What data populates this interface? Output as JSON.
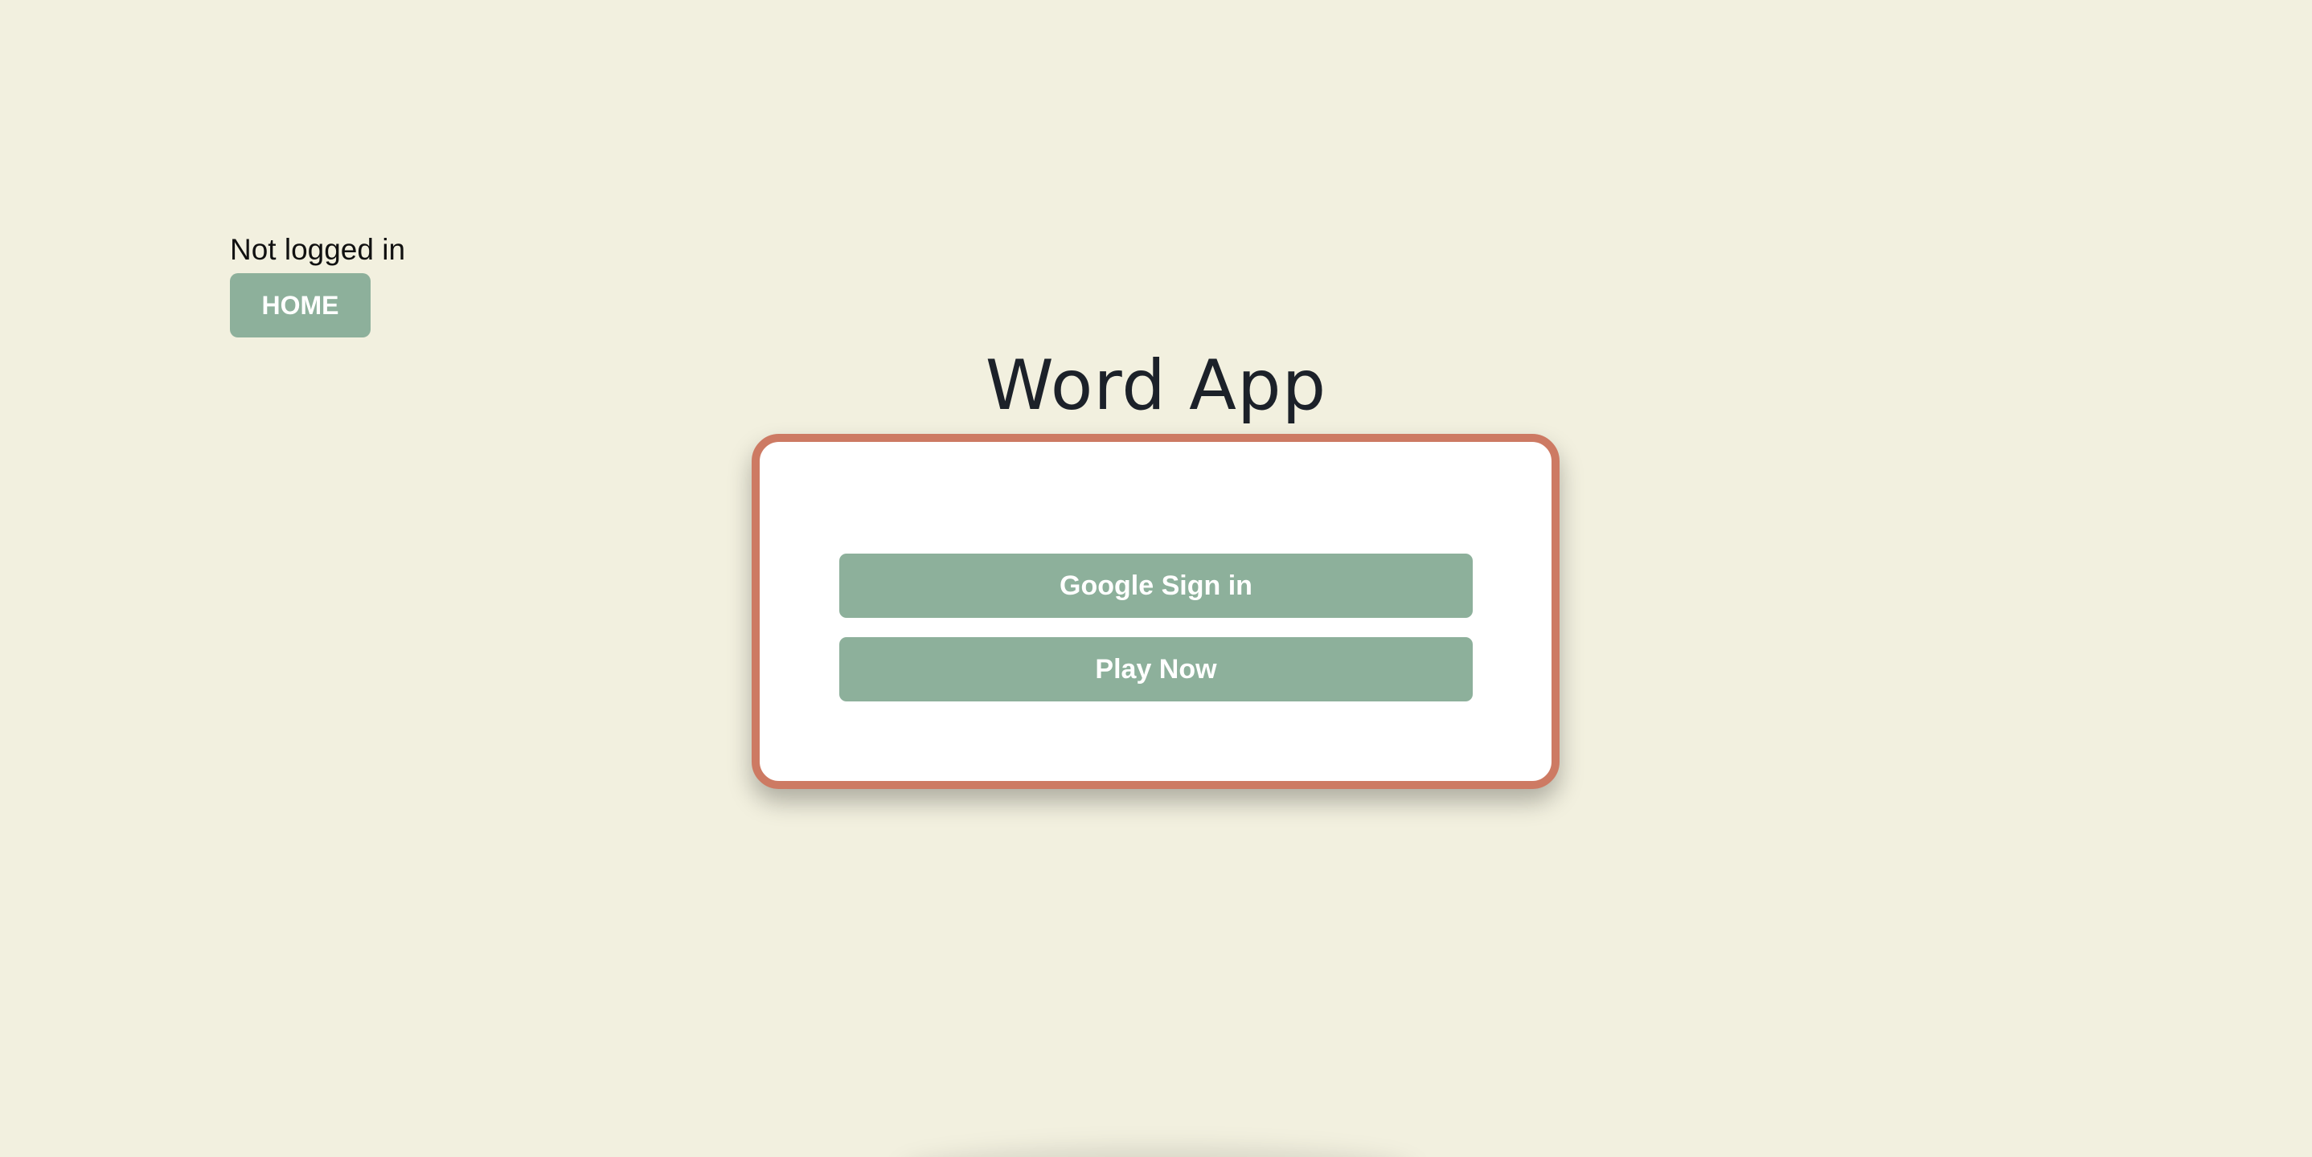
{
  "header": {
    "login_status": "Not logged in",
    "home_label": "HOME"
  },
  "main": {
    "title": "Word App",
    "google_signin_label": "Google Sign in",
    "play_now_label": "Play Now"
  },
  "colors": {
    "background": "#f2f0df",
    "button": "#8db09b",
    "card_border": "#cd7a63",
    "title_text": "#1c2129"
  }
}
